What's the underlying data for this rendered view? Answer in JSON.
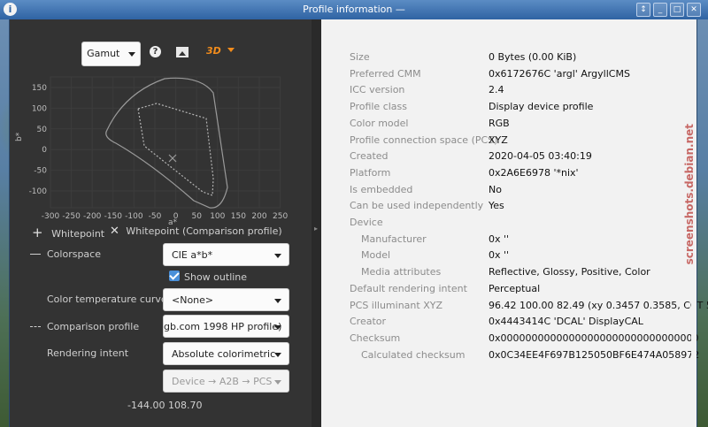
{
  "window": {
    "title": "Profile information —"
  },
  "toolbar": {
    "gamut_label": "Gamut",
    "help_icon": "?",
    "threed_label": "3D"
  },
  "plot": {
    "xlabel": "a*",
    "ylabel": "b*",
    "xticks": [
      "-300",
      "-250",
      "-200",
      "-150",
      "-100",
      "-50",
      "0",
      "50",
      "100",
      "150",
      "200",
      "250"
    ],
    "yticks": [
      "150",
      "100",
      "50",
      "0",
      "-50",
      "-100"
    ]
  },
  "legend": {
    "whitepoint": "Whitepoint",
    "whitepoint_comp": "Whitepoint (Comparison profile)"
  },
  "controls": {
    "colorspace_label": "Colorspace",
    "colorspace_value": "CIE a*b*",
    "show_outline": "Show outline",
    "temp_curve_label": "Color temperature curve",
    "temp_curve_value": "<None>",
    "comparison_label": "Comparison profile",
    "comparison_value": "gb.com 1998 HP profile)",
    "intent_label": "Rendering intent",
    "intent_value": "Absolute colorimetric",
    "direction_value": "Device → A2B → PCS"
  },
  "coords": "-144.00 108.70",
  "properties": [
    {
      "key": "Size",
      "value": "0 Bytes (0.00 KiB)",
      "indent": false
    },
    {
      "key": "Preferred CMM",
      "value": "0x6172676C 'argl' ArgyllCMS",
      "indent": false
    },
    {
      "key": "ICC version",
      "value": "2.4",
      "indent": false
    },
    {
      "key": "Profile class",
      "value": "Display device profile",
      "indent": false
    },
    {
      "key": "Color model",
      "value": "RGB",
      "indent": false
    },
    {
      "key": "Profile connection space (PCS)",
      "value": "XYZ",
      "indent": false
    },
    {
      "key": "Created",
      "value": "2020-04-05 03:40:19",
      "indent": false
    },
    {
      "key": "Platform",
      "value": "0x2A6E6978 '*nix'",
      "indent": false
    },
    {
      "key": "Is embedded",
      "value": "No",
      "indent": false
    },
    {
      "key": "Can be used independently",
      "value": "Yes",
      "indent": false
    },
    {
      "key": "Device",
      "value": "",
      "indent": false
    },
    {
      "key": "Manufacturer",
      "value": "0x ''",
      "indent": true
    },
    {
      "key": "Model",
      "value": "0x ''",
      "indent": true
    },
    {
      "key": "Media attributes",
      "value": "Reflective, Glossy, Positive, Color",
      "indent": true
    },
    {
      "key": "Default rendering intent",
      "value": "Perceptual",
      "indent": false
    },
    {
      "key": "PCS illuminant XYZ",
      "value": "96.42 100.00  82.49 (xy 0.3457 0.3585, CCT 5",
      "indent": false
    },
    {
      "key": "Creator",
      "value": "0x4443414C 'DCAL' DisplayCAL",
      "indent": false
    },
    {
      "key": "Checksum",
      "value": "0x00000000000000000000000000000000",
      "indent": false
    },
    {
      "key": "Calculated checksum",
      "value": "0x0C34EE4F697B125050BF6E474A058972",
      "indent": true
    }
  ],
  "watermark": "screenshots.debian.net"
}
